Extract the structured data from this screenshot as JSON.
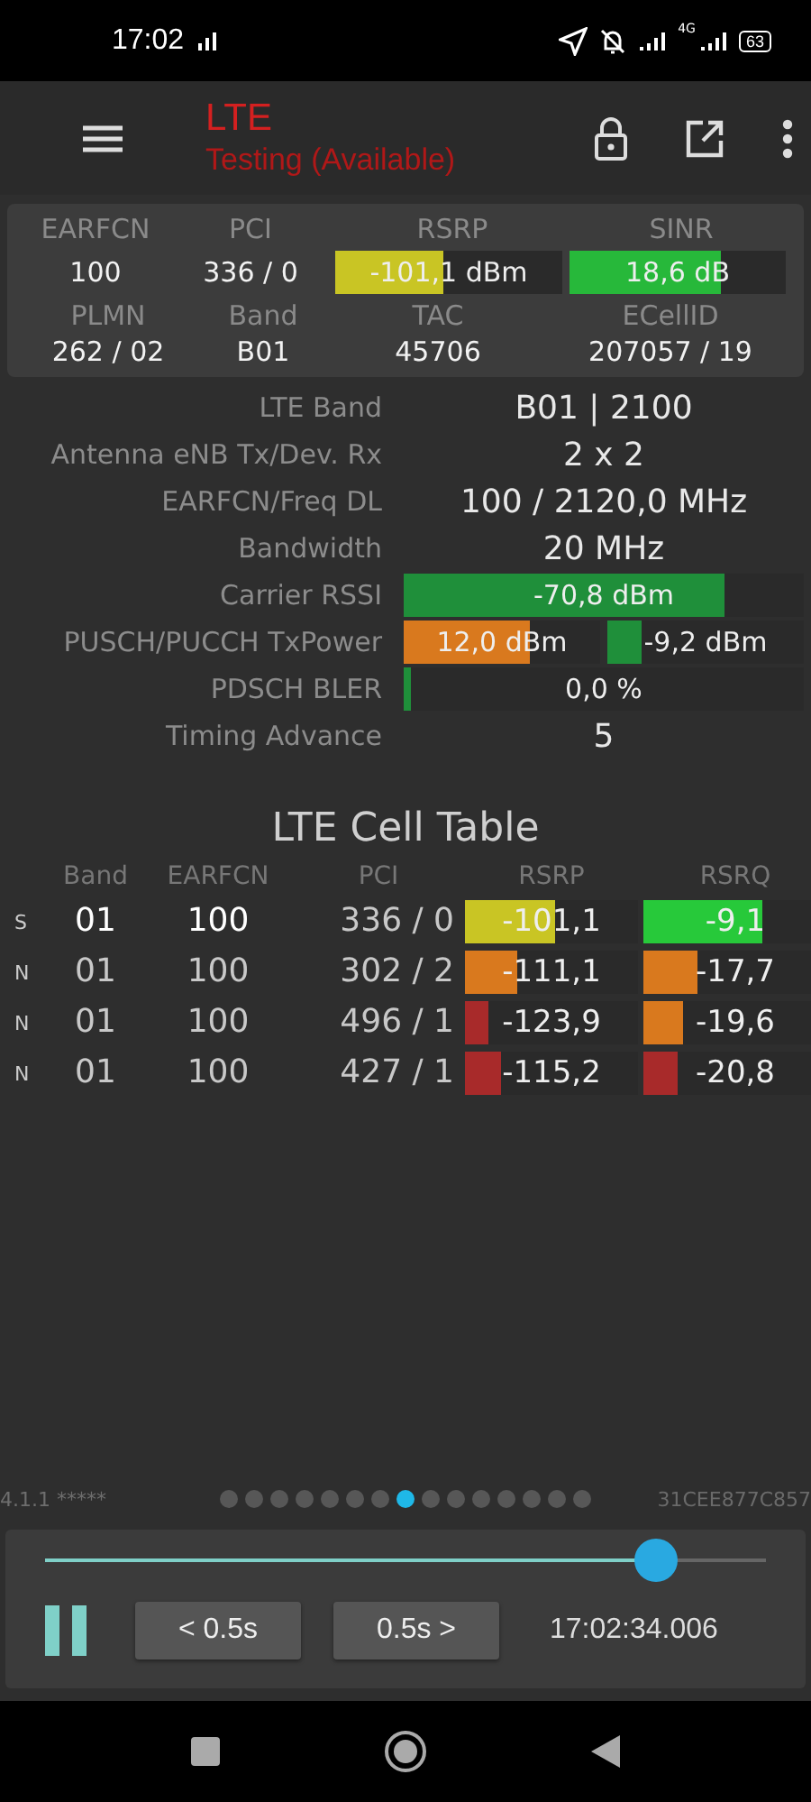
{
  "status_bar": {
    "time": "17:02",
    "network": "4G",
    "battery": "63"
  },
  "app_bar": {
    "title": "LTE",
    "subtitle": "Testing (Available)"
  },
  "summary": {
    "headers1": [
      "EARFCN",
      "PCI",
      "RSRP",
      "SINR"
    ],
    "earfcn": "100",
    "pci": "336 / 0",
    "meters": [
      {
        "reading": "-101,1 dBm",
        "level": 0.48,
        "color": "#c9c524"
      },
      {
        "reading": "18,6 dB",
        "level": 0.7,
        "color": "#27b83a"
      }
    ],
    "headers2": [
      "PLMN",
      "Band",
      "TAC",
      "ECellID"
    ],
    "values2": [
      "262 / 02",
      "B01",
      "45706",
      "207057 / 19"
    ]
  },
  "details": [
    {
      "kind": "text",
      "label": "LTE Band",
      "value": "B01 | 2100"
    },
    {
      "kind": "text",
      "label": "Antenna eNB Tx/Dev. Rx",
      "value": "2 x 2"
    },
    {
      "kind": "text",
      "label": "EARFCN/Freq DL",
      "value": "100 / 2120,0 MHz"
    },
    {
      "kind": "text",
      "label": "Bandwidth",
      "value": "20 MHz"
    },
    {
      "kind": "meter",
      "label": "Carrier RSSI",
      "meters": [
        {
          "reading": "-70,8 dBm",
          "level": 0.8,
          "color": "#1f8f3a"
        }
      ]
    },
    {
      "kind": "meter",
      "label": "PUSCH/PUCCH TxPower",
      "meters": [
        {
          "reading": "12,0 dBm",
          "level": 0.64,
          "color": "#d9791e"
        },
        {
          "reading": "-9,2 dBm",
          "level": 0.17,
          "color": "#1f8f3a"
        }
      ]
    },
    {
      "kind": "meter",
      "label": "PDSCH BLER",
      "meters": [
        {
          "reading": "0,0 %",
          "level": 0.02,
          "color": "#1f8f3a"
        }
      ]
    },
    {
      "kind": "text",
      "label": "Timing Advance",
      "value": "5"
    }
  ],
  "cell_table": {
    "title": "LTE Cell Table",
    "columns": [
      "Band",
      "EARFCN",
      "PCI",
      "RSRP",
      "RSRQ"
    ],
    "rows": [
      {
        "type": "S",
        "serving": true,
        "band": "01",
        "earfcn": "100",
        "pci": "336 / 0",
        "rsrp": {
          "reading": "-101,1",
          "level": 0.52,
          "color": "#c9c524"
        },
        "rsrq": {
          "reading": "-9,1",
          "level": 0.65,
          "color": "#27c93a"
        }
      },
      {
        "type": "N",
        "serving": false,
        "band": "01",
        "earfcn": "100",
        "pci": "302 / 2",
        "rsrp": {
          "reading": "-111,1",
          "level": 0.3,
          "color": "#d9791e"
        },
        "rsrq": {
          "reading": "-17,7",
          "level": 0.29,
          "color": "#d9791e"
        }
      },
      {
        "type": "N",
        "serving": false,
        "band": "01",
        "earfcn": "100",
        "pci": "496 / 1",
        "rsrp": {
          "reading": "-123,9",
          "level": 0.14,
          "color": "#a82a2a"
        },
        "rsrq": {
          "reading": "-19,6",
          "level": 0.22,
          "color": "#d9791e"
        }
      },
      {
        "type": "N",
        "serving": false,
        "band": "01",
        "earfcn": "100",
        "pci": "427 / 1",
        "rsrp": {
          "reading": "-115,2",
          "level": 0.21,
          "color": "#a82a2a"
        },
        "rsrq": {
          "reading": "-20,8",
          "level": 0.19,
          "color": "#a82a2a"
        }
      }
    ]
  },
  "footer": {
    "version": "4.1.1 *****",
    "device_id": "31CEE877C857",
    "pages": [
      {
        "selected": false
      },
      {
        "selected": false
      },
      {
        "selected": false
      },
      {
        "selected": false
      },
      {
        "selected": false
      },
      {
        "selected": false
      },
      {
        "selected": false
      },
      {
        "selected": true
      },
      {
        "selected": false
      },
      {
        "selected": false
      },
      {
        "selected": false
      },
      {
        "selected": false
      },
      {
        "selected": false
      },
      {
        "selected": false
      },
      {
        "selected": false
      }
    ]
  },
  "player": {
    "level": 0.8,
    "playing": true,
    "buttons": [
      "< 0.5s",
      "0.5s >"
    ],
    "timestamp": "17:02:34.006"
  }
}
